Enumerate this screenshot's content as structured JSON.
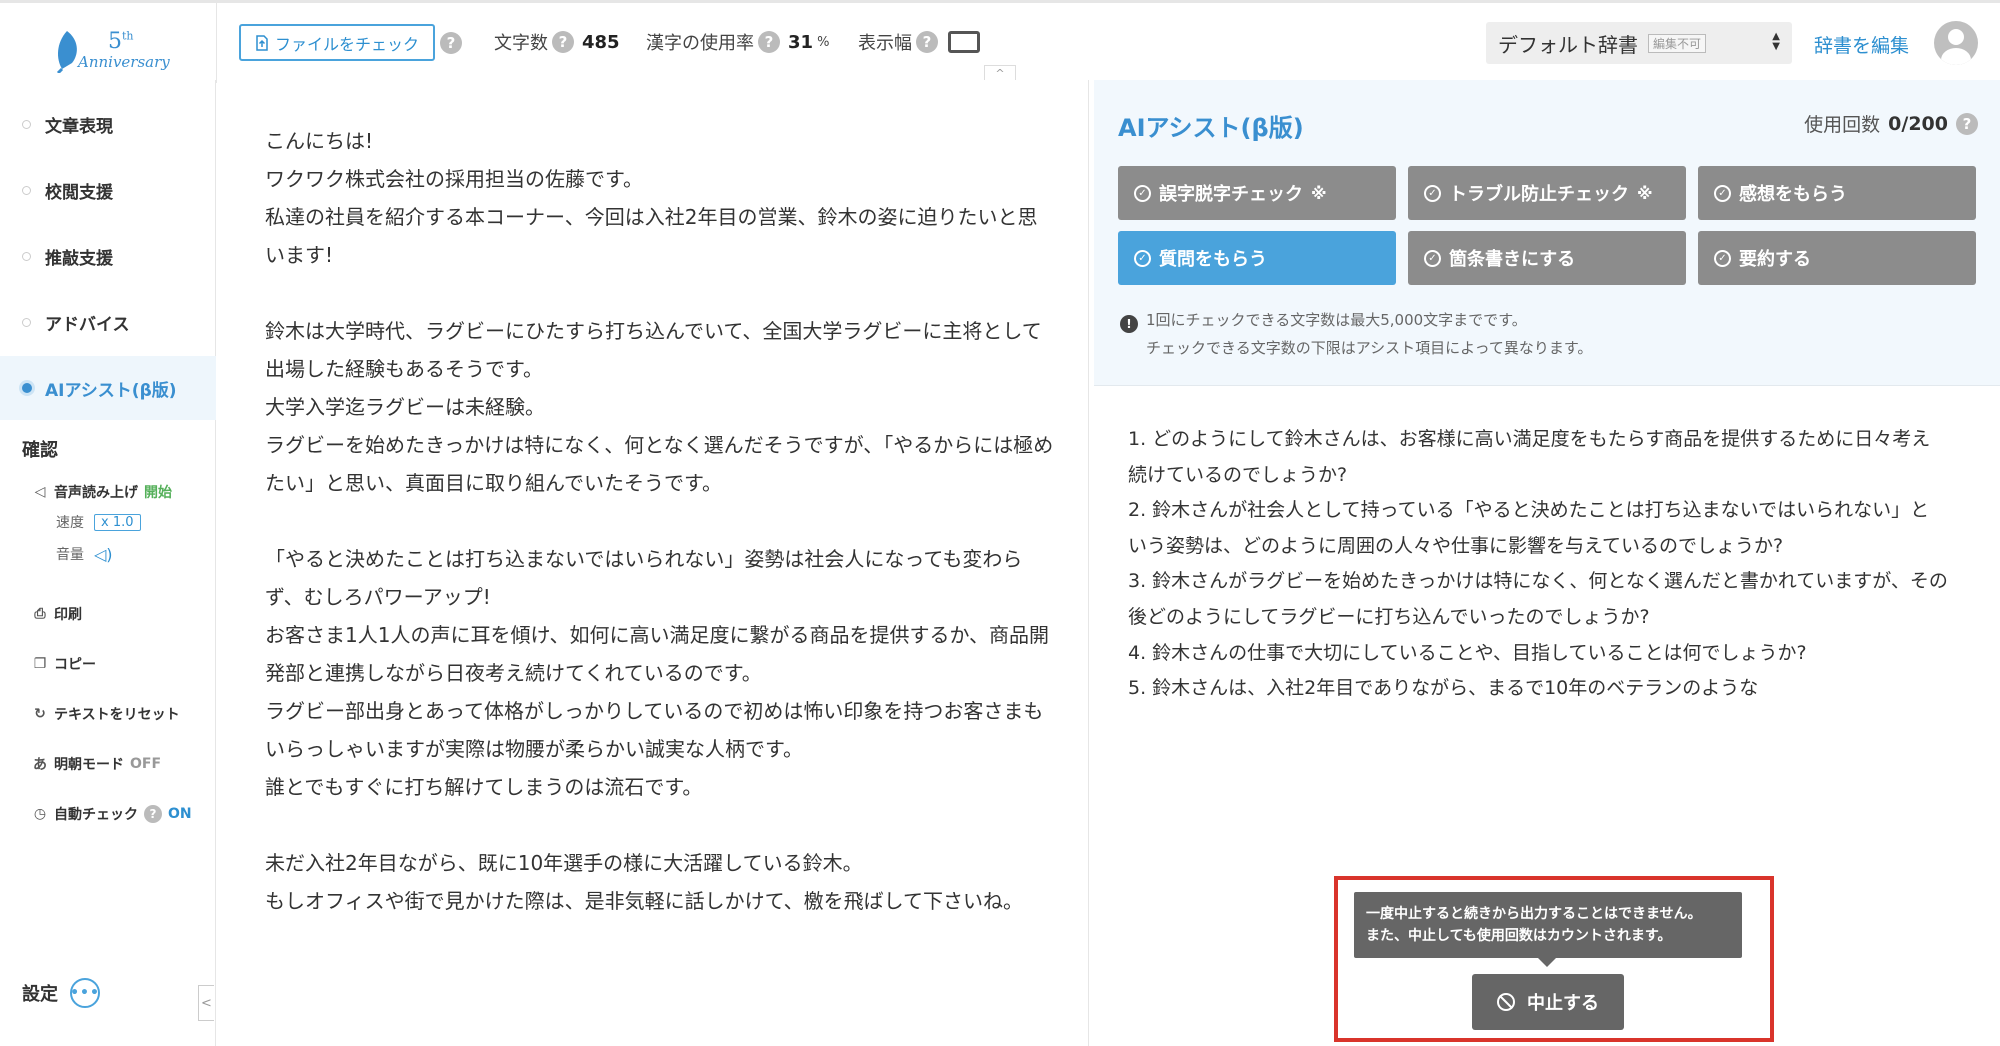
{
  "logo": {
    "number": "5",
    "suffix": "th",
    "text": "Anniversary"
  },
  "toolbar": {
    "file_check": "ファイルをチェック",
    "char_count_label": "文字数",
    "char_count_value": "485",
    "kanji_rate_label": "漢字の使用率",
    "kanji_rate_value": "31",
    "kanji_rate_unit": "%",
    "display_width_label": "表示幅",
    "help_glyph": "?",
    "dictionary": "デフォルト辞書",
    "dictionary_lock": "編集不可",
    "edit_dictionary": "辞書を編集",
    "collapse_glyph": "^"
  },
  "sidebar": {
    "items": [
      {
        "label": "文章表現",
        "active": false
      },
      {
        "label": "校閲支援",
        "active": false
      },
      {
        "label": "推敲支援",
        "active": false
      },
      {
        "label": "アドバイス",
        "active": false
      },
      {
        "label": "AIアシスト(β版)",
        "active": true
      }
    ],
    "confirm_heading": "確認",
    "tts_label": "音声読み上げ",
    "tts_start": "開始",
    "speed_label": "速度",
    "speed_value": "x 1.0",
    "volume_label": "音量",
    "print": "印刷",
    "copy": "コピー",
    "reset": "テキストをリセット",
    "mincho_label": "明朝モード",
    "mincho_state": "OFF",
    "autocheck_label": "自動チェック",
    "autocheck_state": "ON",
    "settings": "設定",
    "more_glyph": "•••",
    "collapse_glyph": "<"
  },
  "editor": {
    "lines": [
      "こんにちは!",
      "ワクワク株式会社の採用担当の佐藤です。",
      "私達の社員を紹介する本コーナー、今回は入社2年目の営業、鈴木の姿に迫りたいと思います!",
      "",
      "鈴木は大学時代、ラグビーにひたすら打ち込んでいて、全国大学ラグビーに主将として出場した経験もあるそうです。",
      "大学入学迄ラグビーは未経験。",
      "ラグビーを始めたきっかけは特になく、何となく選んだそうですが、「やるからには極めたい」と思い、真面目に取り組んでいたそうです。",
      "",
      "「やると決めたことは打ち込まないではいられない」姿勢は社会人になっても変わらず、むしろパワーアップ!",
      "お客さま1人1人の声に耳を傾け、如何に高い満足度に繋がる商品を提供するか、商品開発部と連携しながら日夜考え続けてくれているのです。",
      "ラグビー部出身とあって体格がしっかりしているので初めは怖い印象を持つお客さまもいらっしゃいますが実際は物腰が柔らかい誠実な人柄です。",
      "誰とでもすぐに打ち解けてしまうのは流石です。",
      "",
      "未だ入社2年目ながら、既に10年選手の様に大活躍している鈴木。",
      "もしオフィスや街で見かけた際は、是非気軽に話しかけて、檄を飛ばして下さいね。"
    ]
  },
  "ai": {
    "title": "AIアシスト(β版)",
    "usage_label": "使用回数",
    "usage_value": "0/200",
    "buttons": [
      {
        "label": "誤字脱字チェック",
        "mark": "※",
        "active": false
      },
      {
        "label": "トラブル防止チェック",
        "mark": "※",
        "active": false
      },
      {
        "label": "感想をもらう",
        "mark": "",
        "active": false
      },
      {
        "label": "質問をもらう",
        "mark": "",
        "active": true
      },
      {
        "label": "箇条書きにする",
        "mark": "",
        "active": false
      },
      {
        "label": "要約する",
        "mark": "",
        "active": false
      }
    ],
    "note_line1": "1回にチェックできる文字数は最大5,000文字までです。",
    "note_line2": "チェックできる文字数の下限はアシスト項目によって異なります。",
    "warn_glyph": "!",
    "output": [
      "1. どのようにして鈴木さんは、お客様に高い満足度をもたらす商品を提供するために日々考え続けているのでしょうか?",
      "2. 鈴木さんが社会人として持っている「やると決めたことは打ち込まないではいられない」という姿勢は、どのように周囲の人々や仕事に影響を与えているのでしょうか?",
      "3. 鈴木さんがラグビーを始めたきっかけは特になく、何となく選んだと書かれていますが、その後どのようにしてラグビーに打ち込んでいったのでしょうか?",
      "4. 鈴木さんの仕事で大切にしていることや、目指していることは何でしょうか?",
      "5. 鈴木さんは、入社2年目でありながら、まるで10年のベテランのような"
    ],
    "tooltip_line1": "一度中止すると続きから出力することはできません。",
    "tooltip_line2": "また、中止しても使用回数はカウントされます。",
    "stop_label": "中止する"
  },
  "colors": {
    "accent": "#3a8fd0",
    "button_gray": "#8c8c8c",
    "button_active": "#4aa3dc",
    "highlight": "#d9342b"
  }
}
